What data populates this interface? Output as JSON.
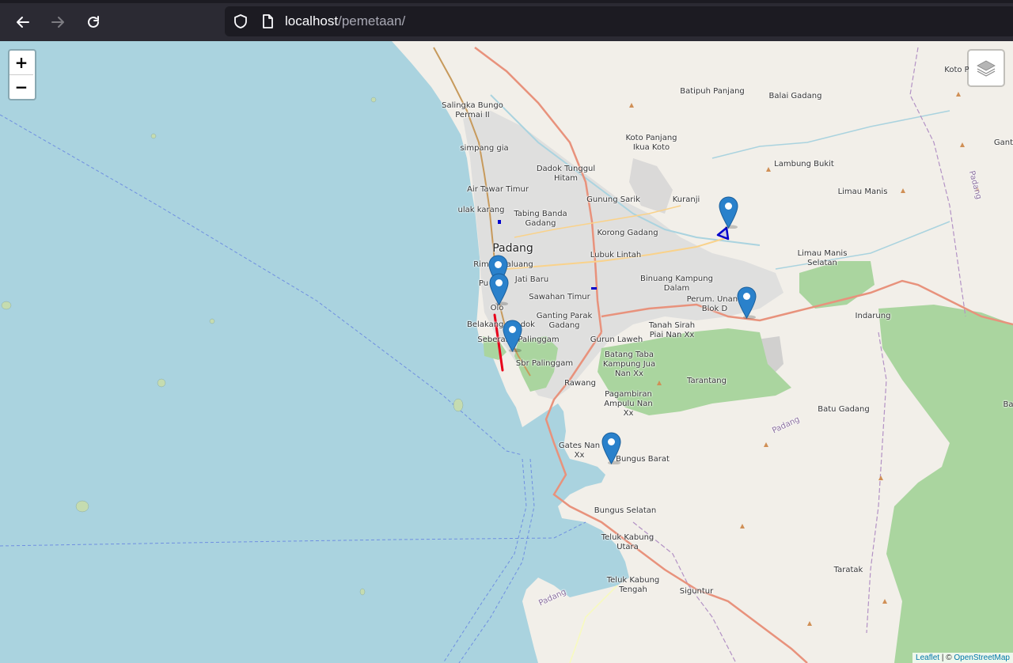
{
  "browser": {
    "url_host": "localhost",
    "url_path": "/pemetaan/",
    "icons": [
      "back-arrow-icon",
      "forward-arrow-icon",
      "reload-icon",
      "shield-icon",
      "page-icon"
    ]
  },
  "map": {
    "zoom_in": "+",
    "zoom_out": "−",
    "city_label": "Padang",
    "places": [
      {
        "id": "salingka",
        "text": "Salingka Bungo\nPermai II"
      },
      {
        "id": "simpang-gia",
        "text": "simpang gia"
      },
      {
        "id": "dadok",
        "text": "Dadok Tunggul\nHitam"
      },
      {
        "id": "air-tawar",
        "text": "Air Tawar Timur"
      },
      {
        "id": "ulak-karang",
        "text": "ulak karang"
      },
      {
        "id": "tabing",
        "text": "Tabing Banda\nGadang"
      },
      {
        "id": "gunung-sarik",
        "text": "Gunung Sarik"
      },
      {
        "id": "kuranji",
        "text": "Kuranji"
      },
      {
        "id": "korong",
        "text": "Korong Gadang"
      },
      {
        "id": "lubuk-lintah",
        "text": "Lubuk Lintah"
      },
      {
        "id": "rimbo",
        "text": "Rimbo Kaluang"
      },
      {
        "id": "jati",
        "text": "Jati Baru"
      },
      {
        "id": "pu",
        "text": "Pu"
      },
      {
        "id": "olo",
        "text": "Olo"
      },
      {
        "id": "sawahan",
        "text": "Sawahan Timur"
      },
      {
        "id": "belakang",
        "text": "Belakang Pondok"
      },
      {
        "id": "ganting",
        "text": "Ganting Parak\nGadang"
      },
      {
        "id": "seberang",
        "text": "Seberang Palinggam"
      },
      {
        "id": "gurun",
        "text": "Gurun Laweh"
      },
      {
        "id": "sbr",
        "text": "Sbr Palinggam"
      },
      {
        "id": "batang",
        "text": "Batang Taba\nKampung Jua\nNan Xx"
      },
      {
        "id": "rawang",
        "text": "Rawang"
      },
      {
        "id": "pagambiran",
        "text": "Pagambiran\nAmpulu Nan\nXx"
      },
      {
        "id": "tarantang",
        "text": "Tarantang"
      },
      {
        "id": "gates",
        "text": "Gates Nan\nXx"
      },
      {
        "id": "bungus-barat",
        "text": "Bungus Barat"
      },
      {
        "id": "bungus-selatan",
        "text": "Bungus Selatan"
      },
      {
        "id": "teluk-utara",
        "text": "Teluk Kabung\nUtara"
      },
      {
        "id": "teluk-tengah",
        "text": "Teluk Kabung\nTengah"
      },
      {
        "id": "siguntur",
        "text": "Siguntur"
      },
      {
        "id": "taratak",
        "text": "Taratak"
      },
      {
        "id": "batu-gadang",
        "text": "Batu Gadang"
      },
      {
        "id": "indarung",
        "text": "Indarung"
      },
      {
        "id": "perum",
        "text": "Perum. Unand\nBlok D"
      },
      {
        "id": "binuang",
        "text": "Binuang Kampung\nDalam"
      },
      {
        "id": "tanah-sirah",
        "text": "Tanah Sirah\nPiai Nan Xx"
      },
      {
        "id": "limau-manis-selatan",
        "text": "Limau Manis\nSelatan"
      },
      {
        "id": "limau-manis",
        "text": "Limau Manis"
      },
      {
        "id": "lambung-bukit",
        "text": "Lambung Bukit"
      },
      {
        "id": "koto-panjang",
        "text": "Koto Panjang\nIkua Koto"
      },
      {
        "id": "batipuh",
        "text": "Batipuh Panjang"
      },
      {
        "id": "balai-gadang",
        "text": "Balai Gadang"
      },
      {
        "id": "koto-p",
        "text": "Koto P"
      },
      {
        "id": "gant",
        "text": "Gant"
      },
      {
        "id": "ba",
        "text": "Ba"
      }
    ],
    "road_labels": [
      "Padang",
      "Padang",
      "Padang"
    ],
    "marker_count": 6,
    "attribution_leaflet": "Leaflet",
    "attribution_sep": " | © ",
    "attribution_osm": "OpenStreetMap"
  },
  "colors": {
    "water": "#aad3df",
    "land": "#f2efe9",
    "forest": "#9fd39a",
    "urban": "#dddddd",
    "motorway": "#e8927c",
    "primary": "#f9d28b",
    "marker": "#2a81cb",
    "polyline": "#e8001a",
    "polygon": "#0000cc"
  }
}
